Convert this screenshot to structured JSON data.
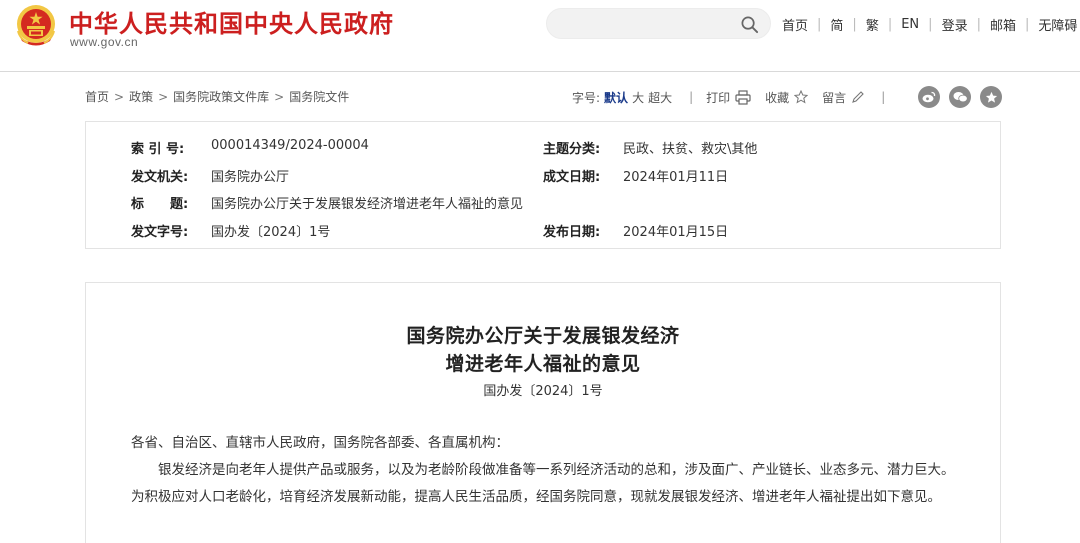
{
  "header": {
    "site_title": "中华人民共和国中央人民政府",
    "site_domain": "www.gov.cn",
    "search_placeholder": "",
    "nav": [
      "首页",
      "简",
      "繁",
      "EN",
      "登录",
      "邮箱",
      "无障碍"
    ],
    "colors": {
      "brand_red": "#cc1f1f",
      "emblem_gold": "#f2c744"
    }
  },
  "breadcrumb": [
    "首页",
    "政策",
    "国务院政策文件库",
    "国务院文件"
  ],
  "toolbar": {
    "font_size_label": "字号:",
    "font_sizes": [
      "默认",
      "大",
      "超大"
    ],
    "active_font_size": "默认",
    "print_label": "打印",
    "favorite_label": "收藏",
    "comment_label": "留言",
    "share_icons": [
      "weibo-icon",
      "wechat-icon",
      "favorite-star-icon"
    ]
  },
  "meta": {
    "index_no_label": "索 引 号:",
    "index_no": "000014349/2024-00004",
    "topic_label": "主题分类:",
    "topic": "民政、扶贫、救灾\\其他",
    "issuer_label": "发文机关:",
    "issuer": "国务院办公厅",
    "created_label": "成文日期:",
    "created": "2024年01月11日",
    "title_label": "标　　题:",
    "title": "国务院办公厅关于发展银发经济增进老年人福祉的意见",
    "doc_no_label": "发文字号:",
    "doc_no": "国办发〔2024〕1号",
    "published_label": "发布日期:",
    "published": "2024年01月15日"
  },
  "article": {
    "title_line1": "国务院办公厅关于发展银发经济",
    "title_line2": "增进老年人福祉的意见",
    "doc_no": "国办发〔2024〕1号",
    "salutation": "各省、自治区、直辖市人民政府，国务院各部委、各直属机构：",
    "paragraph1": "　　银发经济是向老年人提供产品或服务，以及为老龄阶段做准备等一系列经济活动的总和，涉及面广、产业链长、业态多元、潜力巨大。为积极应对人口老龄化，培育经济发展新动能，提高人民生活品质，经国务院同意，现就发展银发经济、增进老年人福祉提出如下意见。"
  }
}
